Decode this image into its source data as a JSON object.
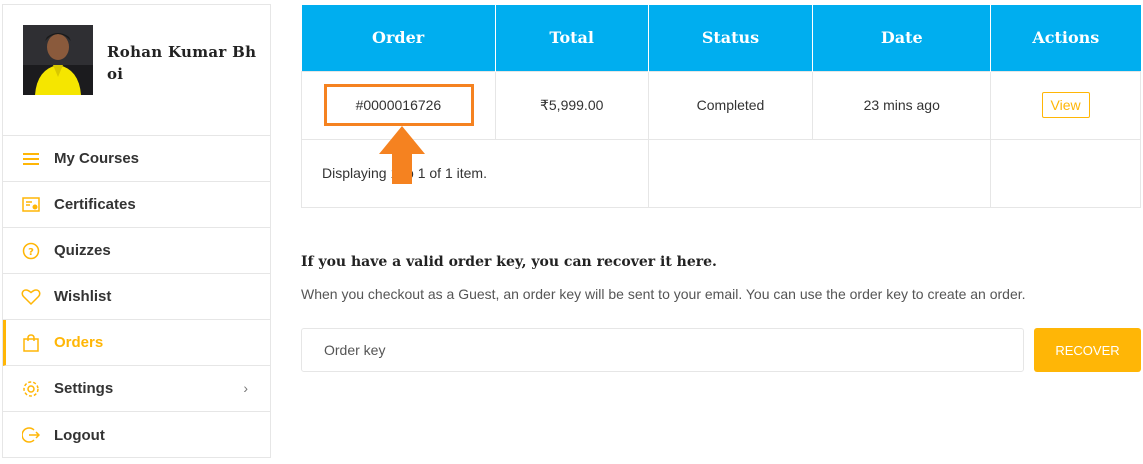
{
  "user": {
    "name": "Rohan Kumar Bhoi"
  },
  "menu": {
    "items": [
      {
        "label": "My Courses",
        "icon": "list-icon",
        "active": false
      },
      {
        "label": "Certificates",
        "icon": "certificate-icon",
        "active": false
      },
      {
        "label": "Quizzes",
        "icon": "question-icon",
        "active": false
      },
      {
        "label": "Wishlist",
        "icon": "heart-icon",
        "active": false
      },
      {
        "label": "Orders",
        "icon": "shopping-bag-icon",
        "active": true
      },
      {
        "label": "Settings",
        "icon": "gear-icon",
        "active": false,
        "has_submenu": true
      },
      {
        "label": "Logout",
        "icon": "logout-icon",
        "active": false
      }
    ]
  },
  "orders": {
    "columns": [
      "Order",
      "Total",
      "Status",
      "Date",
      "Actions"
    ],
    "rows": [
      {
        "order": "#0000016726",
        "total": "₹5,999.00",
        "status": "Completed",
        "date": "23 mins ago",
        "action": "View"
      }
    ],
    "summary": "Displaying 1 to 1 of 1 item."
  },
  "recover": {
    "title": "If you have a valid order key, you can recover it here.",
    "description": "When you checkout as a Guest, an order key will be sent to your email. You can use the order key to create an order.",
    "input_placeholder": "Order key",
    "button_label": "RECOVER"
  },
  "colors": {
    "accent": "#ffb606",
    "table_header": "#00aeef",
    "annotation": "#f58220"
  }
}
